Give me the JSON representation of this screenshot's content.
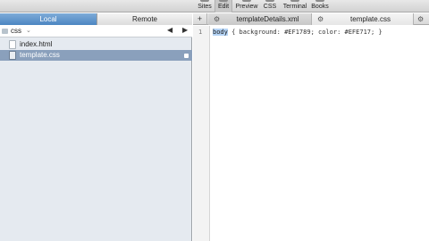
{
  "toolbar": {
    "buttons": [
      {
        "label": "Sites",
        "icon": "sites-icon"
      },
      {
        "label": "Edit",
        "icon": "edit-icon"
      },
      {
        "label": "Preview",
        "icon": "preview-icon"
      },
      {
        "label": "CSS",
        "icon": "css-icon"
      },
      {
        "label": "Terminal",
        "icon": "terminal-icon"
      },
      {
        "label": "Books",
        "icon": "books-icon"
      }
    ],
    "active": "Edit"
  },
  "sidebar": {
    "tabs": {
      "local": "Local",
      "remote": "Remote"
    },
    "active_tab": "Local",
    "path": {
      "folder": "css",
      "chevron": "⌄",
      "back": "◀",
      "forward": "▶"
    },
    "files": [
      {
        "name": "index.html",
        "selected": false
      },
      {
        "name": "template.css",
        "selected": true
      }
    ]
  },
  "editor": {
    "add_tab": "+",
    "tabs": [
      {
        "name": "templateDetails.xml",
        "gear": "⚙",
        "active": false
      },
      {
        "name": "template.css",
        "gear": "⚙",
        "active": true
      }
    ],
    "tab_gear": "⚙",
    "line_number": "1",
    "code": {
      "selected": "body",
      "rest": " { background: #EF1789; color: #EFE717; }"
    }
  },
  "colors": {
    "local_tab": "#5b93cc",
    "selected_row": "#8aa0bc",
    "sidebar_bg": "#e5eaf0",
    "selection": "#b4d3f5"
  }
}
